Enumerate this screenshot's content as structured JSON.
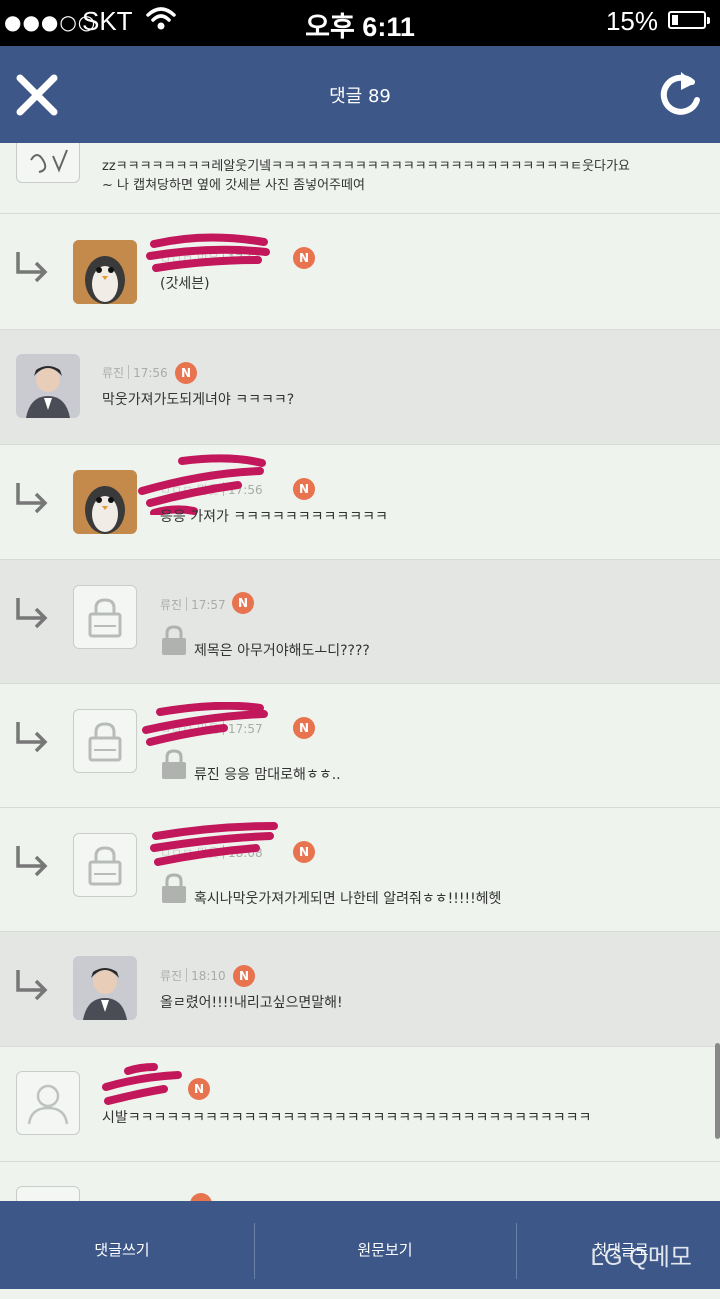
{
  "status_bar": {
    "signal": "●●●○○",
    "carrier": "SKT",
    "time": "오후 6:11",
    "battery": "15%"
  },
  "header": {
    "title": "댓글 89"
  },
  "comments": [
    {
      "text": "zzㅋㅋㅋㅋㅋㅋㅋㅋ레알웃기넼ㅋㅋㅋㅋㅋㅋㅋㅋㅋㅋㅋㅋㅋㅋㅋㅋㅋㅋㅋㅋㅋㅋㅋㅋㅋㅌ웃다가요",
      "text2": "~ 나 캡쳐당하면 옆에 갓세븐 사진 좀넣어주떼여"
    },
    {
      "time": "17:56",
      "badge": "N",
      "text": "(갓세븐)"
    },
    {
      "author": "류진",
      "time": "17:56",
      "badge": "N",
      "text": "막웃가져가도되게녀야 ㅋㅋㅋㅋ?"
    },
    {
      "time": "17:56",
      "badge": "N",
      "text": "응응 가져가 ㅋㅋㅋㅋㅋㅋㅋㅋㅋㅋㅋㅋ"
    },
    {
      "author": "류진",
      "time": "17:57",
      "badge": "N",
      "text": "제목은 아무거야해도ㅗ디????"
    },
    {
      "time": "17:57",
      "badge": "N",
      "text": "류진 응응 맘대로해ㅎㅎ.."
    },
    {
      "time": "18:08",
      "badge": "N",
      "text": "혹시나막웃가져가게되면 나한테 알려줘ㅎㅎ!!!!!헤헷"
    },
    {
      "author": "류진",
      "time": "18:10",
      "badge": "N",
      "text": "올ㄹ렸어!!!!내리고싶으면말해!"
    },
    {
      "badge": "N",
      "text": "시발ㅋㅋㅋㅋㅋㅋㅋㅋㅋㅋㅋㅋㅋㅋㅋㅋㅋㅋㅋㅋㅋㅋㅋㅋㅋㅋㅋㅋㅋㅋㅋㅋㅋㅋㅋㅋ"
    }
  ],
  "footer": {
    "write": "댓글쓰기",
    "original": "원문보기",
    "first": "첫댓글로",
    "watermark": "LG Q메모"
  },
  "colors": {
    "header_bg": "#3c5788",
    "badge": "#e8734f",
    "redaction": "#c2185b",
    "row_gray": "#e4e6e4",
    "row_light": "#eef3ee"
  }
}
